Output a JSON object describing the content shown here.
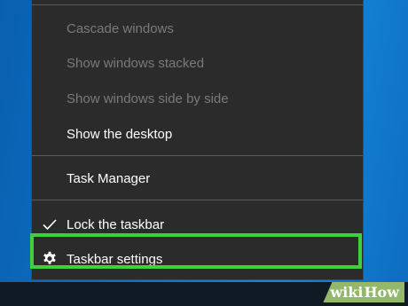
{
  "menu": {
    "items": [
      {
        "label": "Cascade windows",
        "enabled": false
      },
      {
        "label": "Show windows stacked",
        "enabled": false
      },
      {
        "label": "Show windows side by side",
        "enabled": false
      },
      {
        "label": "Show the desktop",
        "enabled": true
      },
      {
        "label": "Task Manager",
        "enabled": true
      },
      {
        "label": "Lock the taskbar",
        "enabled": true,
        "checked": true,
        "icon": "checkmark-icon"
      },
      {
        "label": "Taskbar settings",
        "enabled": true,
        "icon": "gear-icon",
        "highlighted": true
      }
    ]
  },
  "colors": {
    "menu_bg": "#2b2b2b",
    "highlight": "#3ed13e",
    "desktop": "#0e73c6"
  },
  "watermark": {
    "brand_wiki": "wiki",
    "brand_how": "How"
  }
}
